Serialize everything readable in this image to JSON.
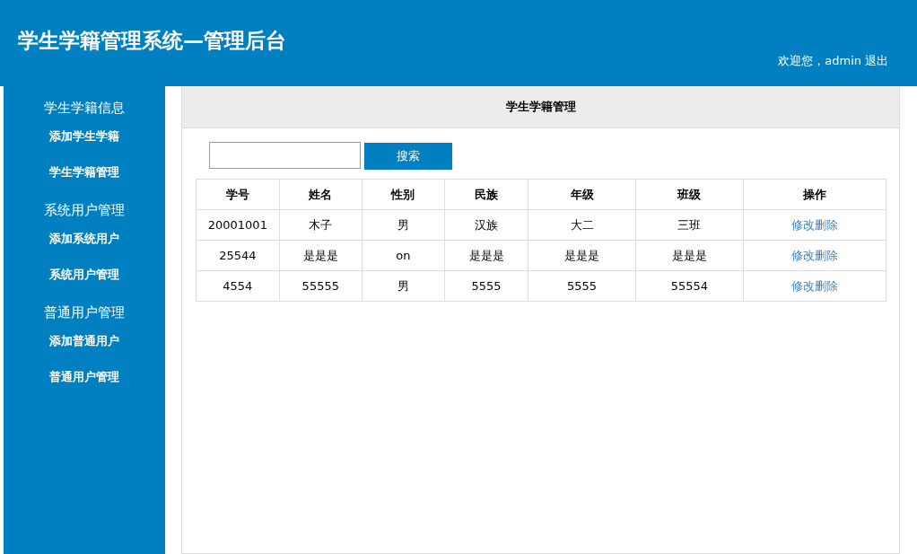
{
  "header": {
    "title": "学生学籍管理系统—管理后台",
    "welcome": "欢迎您，admin",
    "logout": "退出"
  },
  "sidebar": {
    "groups": [
      {
        "title": "学生学籍信息",
        "items": [
          "添加学生学籍",
          "学生学籍管理"
        ]
      },
      {
        "title": "系统用户管理",
        "items": [
          "添加系统用户",
          "系统用户管理"
        ]
      },
      {
        "title": "普通用户管理",
        "items": [
          "添加普通用户",
          "普通用户管理"
        ]
      }
    ]
  },
  "panel": {
    "title": "学生学籍管理",
    "search": {
      "button": "搜索"
    },
    "table": {
      "columns": [
        "学号",
        "姓名",
        "性别",
        "民族",
        "年级",
        "班级",
        "操作"
      ],
      "rows": [
        {
          "cells": [
            "20001001",
            "木子",
            "男",
            "汉族",
            "大二",
            "三班"
          ],
          "actions": [
            "修改",
            "删除"
          ]
        },
        {
          "cells": [
            "25544",
            "是是是",
            "on",
            "是是是",
            "是是是",
            "是是是"
          ],
          "actions": [
            "修改",
            "删除"
          ]
        },
        {
          "cells": [
            "4554",
            "55555",
            "男",
            "5555",
            "5555",
            "55554"
          ],
          "actions": [
            "修改",
            "删除"
          ]
        }
      ]
    }
  }
}
